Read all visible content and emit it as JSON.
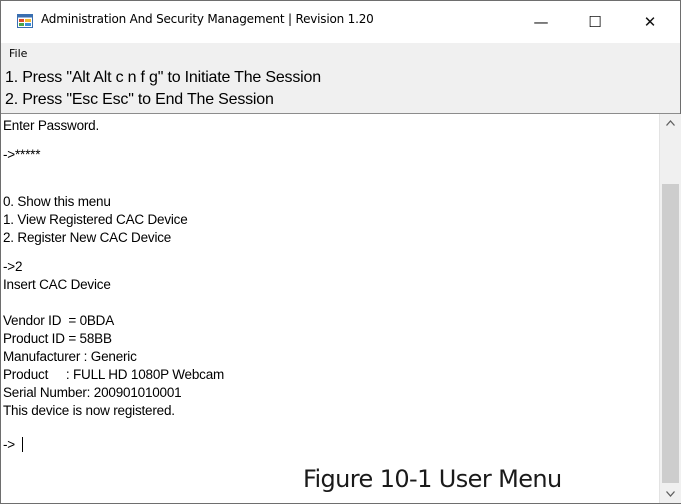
{
  "window": {
    "title": "Administration And Security Management  |  Revision 1.20",
    "controls": {
      "minimize": "—",
      "maximize": "☐",
      "close": "✕"
    }
  },
  "menu": {
    "file": "File"
  },
  "instructions": [
    "1. Press \"Alt Alt c n f g\" to Initiate The Session",
    "2. Press \"Esc Esc\" to End The Session"
  ],
  "console": {
    "lines": [
      "Enter Password.",
      "->*****",
      "0. Show this menu",
      "1. View Registered CAC Device",
      "2. Register New CAC Device",
      "->2",
      "Insert CAC Device",
      "Vendor ID  = 0BDA",
      "Product ID = 58BB",
      "Manufacturer : Generic",
      "Product     : FULL HD 1080P Webcam",
      "Serial Number: 200901010001",
      "This device is now registered.",
      "->"
    ]
  },
  "scrollbar": {
    "up_icon": "chevron-up-icon",
    "down_icon": "chevron-down-icon",
    "position_fraction": 0.2
  },
  "caption": "Figure 10-1 User Menu"
}
